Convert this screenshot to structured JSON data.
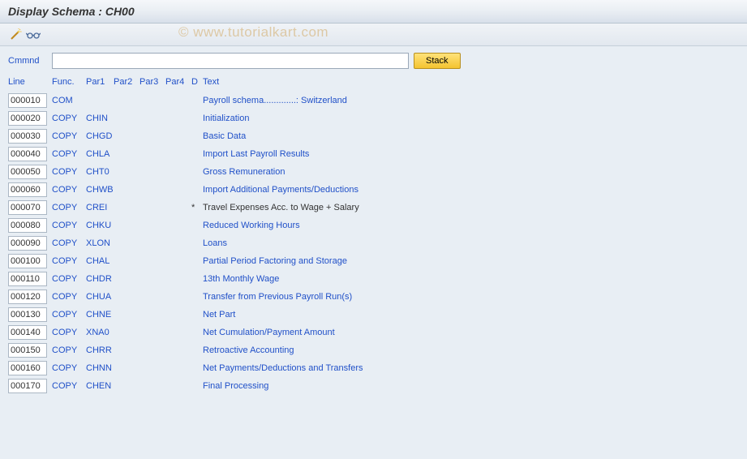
{
  "title": "Display Schema : CH00",
  "watermark": "© www.tutorialkart.com",
  "command": {
    "label": "Cmmnd",
    "value": "",
    "stack_label": "Stack"
  },
  "headers": {
    "line": "Line",
    "func": "Func.",
    "par1": "Par1",
    "par2": "Par2",
    "par3": "Par3",
    "par4": "Par4",
    "d": "D",
    "text": "Text"
  },
  "rows": [
    {
      "line": "000010",
      "func": "COM",
      "par1": "",
      "d": "",
      "text": "Payroll schema.............: Switzerland",
      "muted": false
    },
    {
      "line": "000020",
      "func": "COPY",
      "par1": "CHIN",
      "d": "",
      "text": "Initialization",
      "muted": false
    },
    {
      "line": "000030",
      "func": "COPY",
      "par1": "CHGD",
      "d": "",
      "text": "Basic Data",
      "muted": false
    },
    {
      "line": "000040",
      "func": "COPY",
      "par1": "CHLA",
      "d": "",
      "text": "Import Last Payroll Results",
      "muted": false
    },
    {
      "line": "000050",
      "func": "COPY",
      "par1": "CHT0",
      "d": "",
      "text": "Gross Remuneration",
      "muted": false
    },
    {
      "line": "000060",
      "func": "COPY",
      "par1": "CHWB",
      "d": "",
      "text": "Import Additional Payments/Deductions",
      "muted": false
    },
    {
      "line": "000070",
      "func": "COPY",
      "par1": "CREI",
      "d": "*",
      "text": "Travel Expenses Acc. to Wage + Salary",
      "muted": true
    },
    {
      "line": "000080",
      "func": "COPY",
      "par1": "CHKU",
      "d": "",
      "text": "Reduced Working Hours",
      "muted": false
    },
    {
      "line": "000090",
      "func": "COPY",
      "par1": "XLON",
      "d": "",
      "text": "Loans",
      "muted": false
    },
    {
      "line": "000100",
      "func": "COPY",
      "par1": "CHAL",
      "d": "",
      "text": "Partial Period Factoring and Storage",
      "muted": false
    },
    {
      "line": "000110",
      "func": "COPY",
      "par1": "CHDR",
      "d": "",
      "text": "13th Monthly Wage",
      "muted": false
    },
    {
      "line": "000120",
      "func": "COPY",
      "par1": "CHUA",
      "d": "",
      "text": "Transfer from Previous Payroll Run(s)",
      "muted": false
    },
    {
      "line": "000130",
      "func": "COPY",
      "par1": "CHNE",
      "d": "",
      "text": "Net Part",
      "muted": false
    },
    {
      "line": "000140",
      "func": "COPY",
      "par1": "XNA0",
      "d": "",
      "text": "Net Cumulation/Payment Amount",
      "muted": false
    },
    {
      "line": "000150",
      "func": "COPY",
      "par1": "CHRR",
      "d": "",
      "text": "Retroactive Accounting",
      "muted": false
    },
    {
      "line": "000160",
      "func": "COPY",
      "par1": "CHNN",
      "d": "",
      "text": "Net Payments/Deductions and Transfers",
      "muted": false
    },
    {
      "line": "000170",
      "func": "COPY",
      "par1": "CHEN",
      "d": "",
      "text": "Final Processing",
      "muted": false
    }
  ]
}
